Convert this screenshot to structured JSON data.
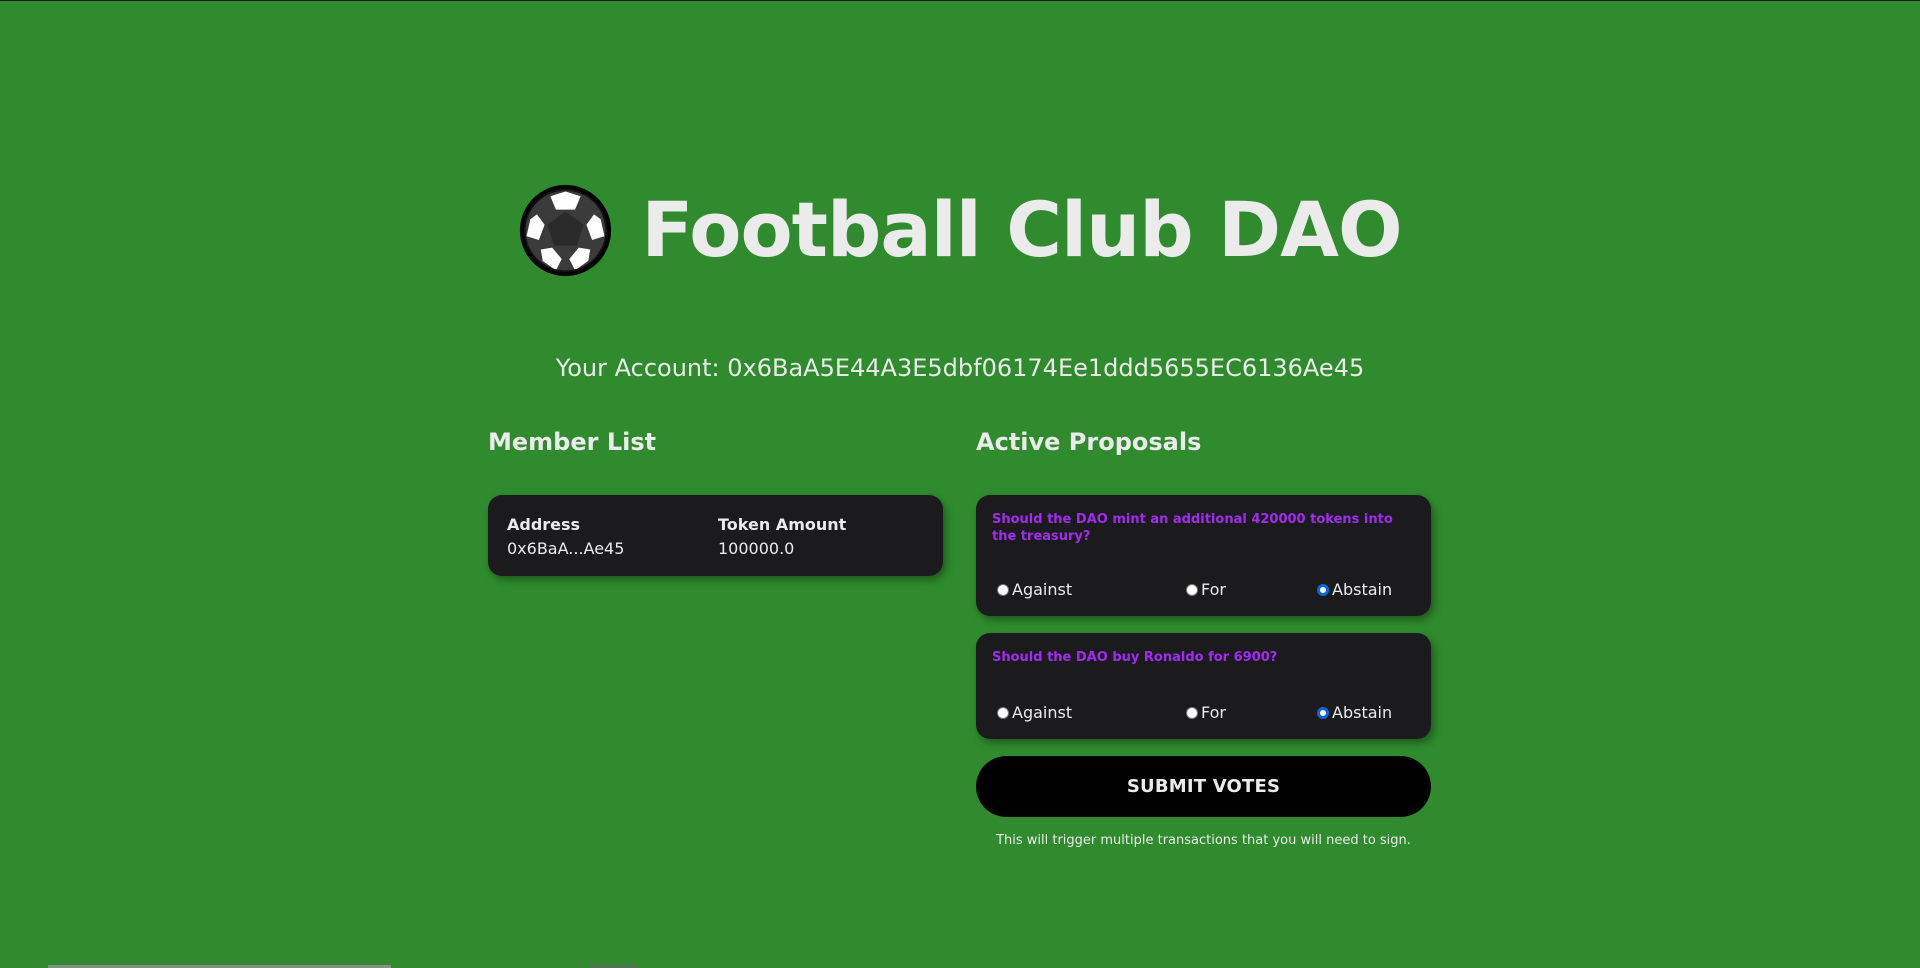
{
  "header": {
    "title": "Football Club DAO",
    "logo_icon": "soccer-ball-icon"
  },
  "account": {
    "label": "Your Account: 0x6BaA5E44A3E5dbf06174Ee1ddd5655EC6136Ae45"
  },
  "members": {
    "title": "Member List",
    "columns": [
      "Address",
      "Token Amount"
    ],
    "rows": [
      [
        "0x6BaA...Ae45",
        "100000.0"
      ]
    ]
  },
  "proposals": {
    "title": "Active Proposals",
    "items": [
      {
        "question": "Should the DAO mint an additional 420000 tokens into the treasury?",
        "options": [
          "Against",
          "For",
          "Abstain"
        ],
        "selected": "Abstain"
      },
      {
        "question": "Should the DAO buy Ronaldo for 6900?",
        "options": [
          "Against",
          "For",
          "Abstain"
        ],
        "selected": "Abstain"
      }
    ],
    "submit_label": "SUBMIT VOTES",
    "note": "This will trigger multiple transactions that you will need to sign."
  },
  "colors": {
    "background": "#2f8b2d",
    "card": "#1b1b1e",
    "question_text": "#a22bf2",
    "text": "#ebebeb",
    "button": "#000000",
    "radio_checked": "#0a66d8"
  }
}
